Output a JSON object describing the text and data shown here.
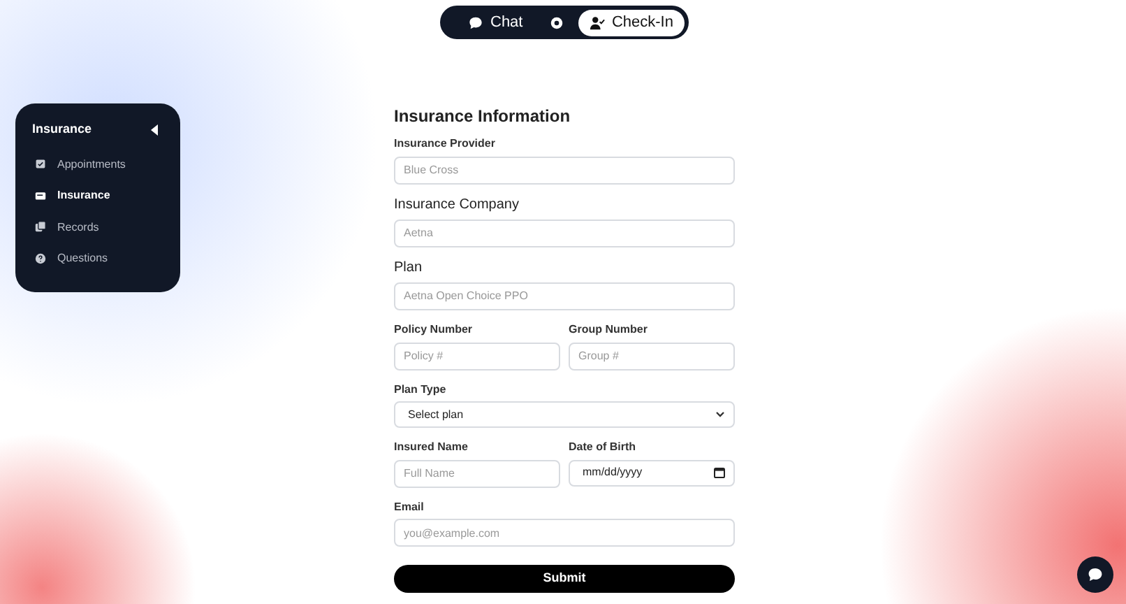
{
  "top_nav": [
    {
      "kind": "chat",
      "label": "Chat",
      "selected": false
    },
    {
      "kind": "dot",
      "selected": false
    },
    {
      "kind": "checkin",
      "label": "Check-In",
      "selected": true
    }
  ],
  "sidebar": {
    "title": "Insurance",
    "items": [
      {
        "kind": "calendar",
        "label": "Appointments",
        "selected": false
      },
      {
        "kind": "card",
        "label": "Insurance",
        "selected": true
      },
      {
        "kind": "records",
        "label": "Records",
        "selected": false
      },
      {
        "kind": "question",
        "label": "Questions",
        "selected": false
      }
    ]
  },
  "form": {
    "title": "Insurance Information",
    "rows": [
      [
        {
          "kind": "text",
          "label": "Insurance Provider",
          "large_label": false,
          "placeholder": "Blue Cross"
        }
      ],
      [
        {
          "kind": "text",
          "label": "Insurance Company",
          "large_label": true,
          "placeholder": "Aetna"
        }
      ],
      [
        {
          "kind": "text",
          "label": "Plan",
          "large_label": true,
          "placeholder": "Aetna Open Choice PPO"
        }
      ],
      [
        {
          "kind": "text",
          "label": "Policy Number",
          "large_label": false,
          "placeholder": "Policy #"
        },
        {
          "kind": "text",
          "label": "Group Number",
          "large_label": false,
          "placeholder": "Group #"
        }
      ],
      [
        {
          "kind": "select",
          "label": "Plan Type",
          "large_label": false,
          "value": "Select plan"
        }
      ],
      [
        {
          "kind": "text",
          "label": "Insured Name",
          "large_label": false,
          "placeholder": "Full Name"
        },
        {
          "kind": "date",
          "label": "Date of Birth",
          "large_label": false,
          "value": "mm/dd/yyyy"
        }
      ],
      [
        {
          "kind": "text",
          "label": "Email",
          "large_label": false,
          "placeholder": "you@example.com"
        }
      ]
    ],
    "submit": "Submit"
  }
}
